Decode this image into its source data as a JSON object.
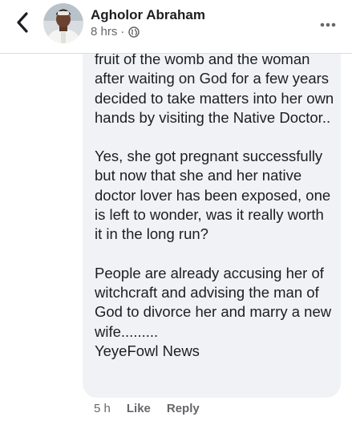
{
  "header": {
    "author_name": "Agholor Abraham",
    "time": "8 hrs",
    "separator": "·",
    "icons": {
      "back": "back-chevron-icon",
      "privacy": "globe-icon",
      "more": "more-dots-icon"
    }
  },
  "comment": {
    "paragraphs": [
      "fruit of the womb and the woman after waiting on God for a few years decided to take matters into her own hands by visiting the Native Doctor..",
      "Yes, she got pregnant successfully but now that she and her native doctor lover has been exposed, one is left to wonder, was it really worth it in the long run?",
      "People are already accusing her of witchcraft and advising the man of God to divorce her and marry a new wife.........\nYeyeFowl News"
    ]
  },
  "actions": {
    "time": "5 h",
    "like_label": "Like",
    "reply_label": "Reply"
  },
  "colors": {
    "bubble_bg": "#f0f2f5",
    "text_primary": "#1c1e21",
    "text_secondary": "#65676b"
  }
}
